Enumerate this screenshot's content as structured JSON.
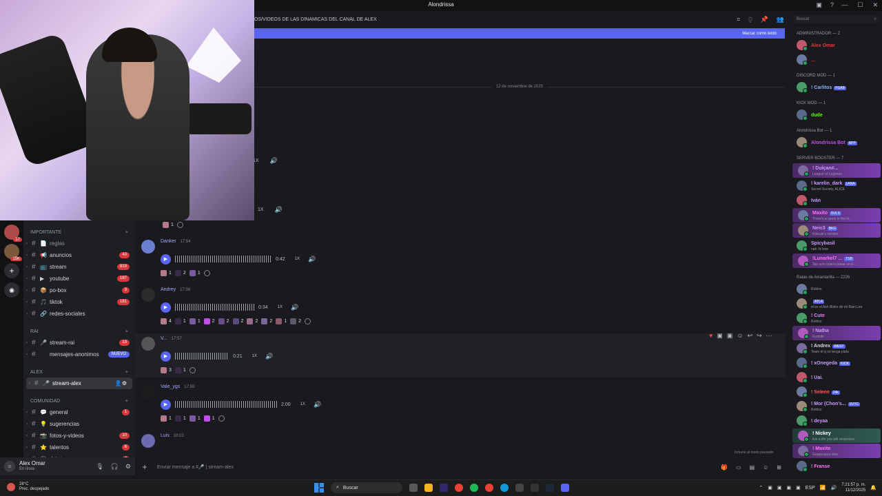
{
  "window": {
    "title": "Alondrissa"
  },
  "channel": {
    "topic": "OS/VIDEOS DE LAS DINAMICAS DEL CANAL DE ALEX",
    "banner_action": "Marcar como leído"
  },
  "date_divider": "12 de noviembre de 2025",
  "servers": [
    {
      "badge": "17"
    },
    {
      "badge": "15K"
    },
    {
      "badge": ""
    },
    {
      "badge": ""
    }
  ],
  "channel_list": {
    "categories": [
      {
        "name": "IMPORTANTE",
        "items": [
          {
            "emoji": "📄",
            "name": "reglas",
            "count": "",
            "dim": true
          },
          {
            "emoji": "📢",
            "name": "anuncios",
            "count": "40"
          },
          {
            "emoji": "📺",
            "name": "stream",
            "count": "819"
          },
          {
            "emoji": "▶",
            "name": "youtube",
            "count": "187"
          },
          {
            "emoji": "📦",
            "name": "po-box",
            "count": "3"
          },
          {
            "emoji": "🎵",
            "name": "tiktok",
            "count": "181"
          },
          {
            "emoji": "🔗",
            "name": "redes-sociales",
            "count": ""
          }
        ]
      },
      {
        "name": "RAI",
        "items": [
          {
            "emoji": "🎤",
            "name": "stream-rai",
            "count": "13"
          },
          {
            "emoji": "",
            "name": "mensajes-anonimos",
            "new": "NUEVO"
          }
        ]
      },
      {
        "name": "ALEX",
        "items": [
          {
            "emoji": "🎤",
            "name": "stream-alex",
            "count": "",
            "active": true
          }
        ]
      },
      {
        "name": "COMUNIDAD",
        "items": [
          {
            "emoji": "💬",
            "name": "general",
            "count": "1"
          },
          {
            "emoji": "💡",
            "name": "sugerencias",
            "count": ""
          },
          {
            "emoji": "📸",
            "name": "fotos-y-videos",
            "count": "10"
          },
          {
            "emoji": "⭐",
            "name": "talentos",
            "count": "6"
          },
          {
            "emoji": "🎧",
            "name": "dejate-ver",
            "count": "4"
          }
        ]
      }
    ]
  },
  "user": {
    "name": "Alex Omar",
    "status": "En línea"
  },
  "messages": [
    {
      "name": "Danker",
      "time": "17:54",
      "duration": "0:42",
      "speed": "1X",
      "reactions": [
        "1",
        "2",
        "1"
      ]
    },
    {
      "name": "Andrey",
      "time": "17:56",
      "duration": "0:34",
      "speed": "1X",
      "reactions": [
        "4",
        "1",
        "1",
        "2",
        "2",
        "2",
        "2",
        "2",
        "1",
        "2"
      ]
    },
    {
      "name": "V...",
      "time": "17:57",
      "duration": "0:21",
      "speed": "1X",
      "reactions": [
        "3",
        "1"
      ]
    },
    {
      "name": "Vale_ygs",
      "time": "17:59",
      "duration": "2:00",
      "speed": "1X",
      "reactions": [
        "1",
        "1",
        "1",
        "1"
      ]
    },
    {
      "name": "Luis",
      "time": "18:03"
    }
  ],
  "old_audio": [
    {
      "speed": "1X"
    },
    {
      "speed": "1X"
    }
  ],
  "composer": {
    "placeholder": "Enviar mensaje a #🎤 | stream-alex"
  },
  "slowmode": "Inmune al modo pausado",
  "members": {
    "search_placeholder": "Buscar",
    "groups": [
      {
        "name": "ADMINISTRADOR — 2",
        "members": [
          {
            "name": "Alex Omar",
            "color": "#e03c3c",
            "sub": ""
          },
          {
            "name": "...",
            "color": "#e03c3c",
            "sub": ""
          }
        ]
      },
      {
        "name": "DISCORD MOD — 1",
        "members": [
          {
            "name": "! Carlitos",
            "color": "#7fb2ff",
            "sub": "",
            "tag": "FGAB"
          }
        ]
      },
      {
        "name": "KICK MOD — 1",
        "members": [
          {
            "name": "dude",
            "color": "#53fc18",
            "sub": ""
          }
        ]
      },
      {
        "name": "Alondrissa Bot — 1",
        "members": [
          {
            "name": "Alondrissa Bot",
            "color": "#c04ee8",
            "sub": "",
            "tag": "APP"
          }
        ]
      },
      {
        "name": "SERVER BOOSTER — 7",
        "members": [
          {
            "name": "! Dulçan#...",
            "color": "#c89bff",
            "sub": "League of Legends",
            "hl": "hl"
          },
          {
            "name": "! karelin_dark",
            "color": "#c89bff",
            "sub": "Secret Society, ALICE",
            "tag": "LANA"
          },
          {
            "name": "Iván",
            "color": "#c89bff",
            "sub": ""
          },
          {
            "name": "Maxito",
            "color": "#ff73fa",
            "sub": "There's a spark in the bl...",
            "hl": "hl",
            "tag": "RVLS"
          },
          {
            "name": "Neic3",
            "color": "#c89bff",
            "sub": "Katsuki's version",
            "hl": "hl",
            "tag": "BKG"
          },
          {
            "name": "Spicybasil",
            "color": "#c89bff",
            "sub": "nah i'd lose"
          },
          {
            "name": "!Lunarkel7 ...",
            "color": "#ff73fa",
            "sub": "Tan solo quiero pasar un b...",
            "hl": "hl",
            "tag": "TSB"
          }
        ]
      },
      {
        "name": "Ratas de Alcantarilla — 2226",
        "members": [
          {
            "name": "",
            "color": "#fff",
            "sub": "Roblox"
          },
          {
            "name": "",
            "color": "#fff",
            "sub": "el es el Ash Blake de mi Rain Lee",
            "tag": "ATLA"
          },
          {
            "name": "! Cute",
            "color": "#ff73fa",
            "sub": "Roblox"
          },
          {
            "name": "! Natha",
            "color": "#c89bff",
            "sub": "Fortnite",
            "hl": "hl"
          },
          {
            "name": "! Andrex",
            "color": "#ddd",
            "sub": "Team el q no tenga plata",
            "tag": "WEST"
          },
          {
            "name": "! xOnegeda",
            "color": "#c89bff",
            "sub": "",
            "tag": "KICK"
          },
          {
            "name": "! Uai.",
            "color": "#c89bff",
            "sub": ""
          },
          {
            "name": "! Selene",
            "color": "#ff5a5a",
            "sub": "",
            "tag": "24k"
          },
          {
            "name": "! Mor (Chon's...",
            "color": "#c89bff",
            "sub": "Roblox",
            "tag": "SVTC"
          },
          {
            "name": "! deyaa",
            "color": "#c89bff",
            "sub": ""
          },
          {
            "name": "! Nickey",
            "color": "#ffffff",
            "sub": "live a life you will remember",
            "hl": "hl2"
          },
          {
            "name": "! Maxito",
            "color": "#ff73fa",
            "sub": "Guapa para dios",
            "hl": "hl"
          },
          {
            "name": "! Franse",
            "color": "#ff73fa",
            "sub": ""
          }
        ]
      }
    ]
  },
  "taskbar": {
    "weather_temp": "28°C",
    "weather_desc": "Prec. despejado",
    "search": "Buscar",
    "lang": "ESP",
    "time": "7:21:57 p. m.",
    "date": "11/12/2025"
  },
  "colors": {
    "accent": "#5865f2",
    "danger": "#da373c"
  }
}
